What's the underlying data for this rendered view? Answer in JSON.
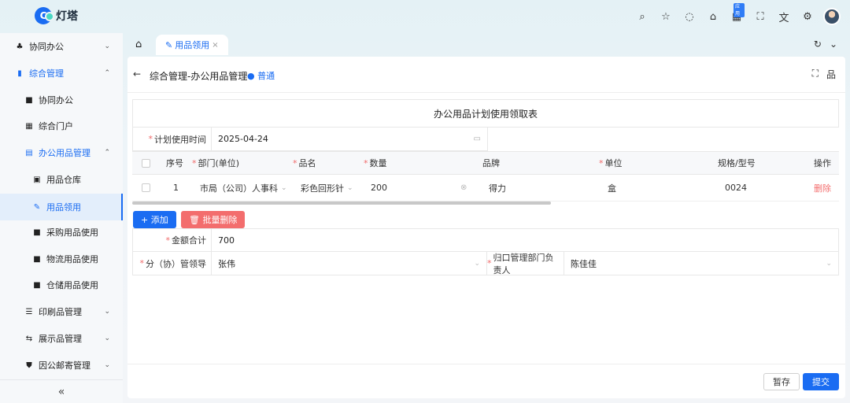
{
  "app": {
    "name": "灯塔",
    "logo_glyph": "C"
  },
  "top_icons": [
    "search-icon",
    "star-icon",
    "chat-icon",
    "bell-icon",
    "apps-icon",
    "fullscreen-icon",
    "translate-icon",
    "gear-icon"
  ],
  "top_badge": "应用",
  "sidebar": {
    "items": [
      {
        "label": "协同办公",
        "icon": "people-icon",
        "glyph": "♣",
        "chev": "⌄"
      },
      {
        "label": "综合管理",
        "icon": "book-icon",
        "glyph": "▮",
        "chev": "⌃"
      },
      {
        "label": "协同办公",
        "icon": "doc-icon",
        "glyph": "■"
      },
      {
        "label": "综合门户",
        "icon": "grid-icon",
        "glyph": "▦"
      },
      {
        "label": "办公用品管理",
        "icon": "file-icon",
        "glyph": "▤",
        "chev": "⌃"
      },
      {
        "label": "用品仓库",
        "icon": "box-icon",
        "glyph": "▣"
      },
      {
        "label": "用品领用",
        "icon": "edit-icon",
        "glyph": "✎"
      },
      {
        "label": "采购用品使用",
        "icon": "doc-icon",
        "glyph": "■"
      },
      {
        "label": "物流用品使用",
        "icon": "doc-icon",
        "glyph": "■"
      },
      {
        "label": "仓储用品使用",
        "icon": "doc-icon",
        "glyph": "■"
      },
      {
        "label": "印刷品管理",
        "icon": "list-icon",
        "glyph": "☰",
        "chev": "⌄"
      },
      {
        "label": "展示品管理",
        "icon": "swap-icon",
        "glyph": "⇆",
        "chev": "⌄"
      },
      {
        "label": "因公邮寄管理",
        "icon": "shield-icon",
        "glyph": "⛊",
        "chev": "⌄"
      }
    ],
    "collapse": "«"
  },
  "tabs": {
    "home": "⌂",
    "active": {
      "icon": "✎",
      "label": "用品领用",
      "close": "×"
    },
    "refresh": "↻",
    "dropdown": "⌄"
  },
  "page": {
    "back": "←",
    "title": "综合管理-办公用品管理",
    "status": "● 普通",
    "icon_full": "⛶",
    "icon_tree": "品"
  },
  "form": {
    "title": "办公用品计划使用领取表",
    "date_label": "计划使用时间",
    "date_value": "2025-04-24",
    "calendar_glyph": "▭",
    "table": {
      "headers": [
        "序号",
        "部门(单位)",
        "品名",
        "数量",
        "品牌",
        "单位",
        "规格/型号",
        "操作"
      ],
      "required": [
        "",
        "*",
        "*",
        "*",
        "",
        "*",
        "",
        ""
      ],
      "rows": [
        {
          "index": "1",
          "dept": "市局（公司）人事科",
          "name": "彩色回形针",
          "qty": "200",
          "brand": "得力",
          "unit": "盒",
          "spec": "0024",
          "action": "删除"
        }
      ]
    },
    "add_button": "+ 添加",
    "batch_delete_button": "🗑 批量删除",
    "amount_label": "金额合计",
    "amount_value": "700",
    "leader_label": "分（协）管领导",
    "leader_value": "张伟",
    "dept_head_label": "归口管理部门负责人",
    "dept_head_value": "陈佳佳",
    "required_mark": "*",
    "chev": "⌄"
  },
  "footer": {
    "save": "暂存",
    "submit": "提交"
  },
  "colors": {
    "primary": "#1a6cf2",
    "danger": "#f36d6d",
    "required": "#f06a6a"
  }
}
